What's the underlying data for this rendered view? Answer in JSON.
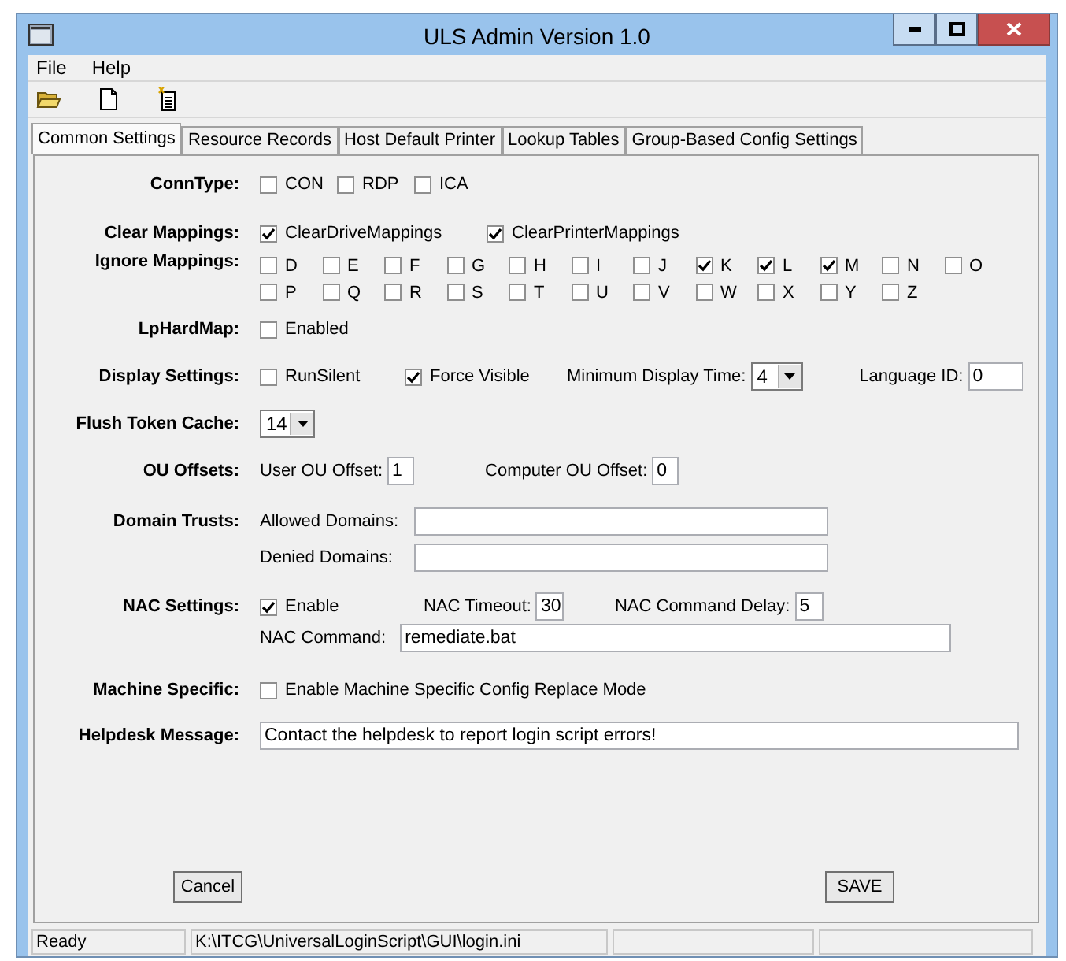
{
  "window": {
    "title": "ULS Admin Version 1.0"
  },
  "menu": [
    "File",
    "Help"
  ],
  "tabs": [
    {
      "label": "Common Settings",
      "selected": true
    },
    {
      "label": "Resource Records",
      "selected": false
    },
    {
      "label": "Host Default Printer",
      "selected": false
    },
    {
      "label": "Lookup Tables",
      "selected": false
    },
    {
      "label": "Group-Based Config Settings",
      "selected": false
    }
  ],
  "conn_type": {
    "label": "ConnType:",
    "options": [
      {
        "label": "CON",
        "checked": false
      },
      {
        "label": "RDP",
        "checked": false
      },
      {
        "label": "ICA",
        "checked": false
      }
    ]
  },
  "clear_mappings": {
    "label": "Clear Mappings:",
    "options": [
      {
        "label": "ClearDriveMappings",
        "checked": true
      },
      {
        "label": "ClearPrinterMappings",
        "checked": true
      }
    ]
  },
  "ignore_mappings": {
    "label": "Ignore Mappings:",
    "options": [
      {
        "label": "D",
        "checked": false
      },
      {
        "label": "E",
        "checked": false
      },
      {
        "label": "F",
        "checked": false
      },
      {
        "label": "G",
        "checked": false
      },
      {
        "label": "H",
        "checked": false
      },
      {
        "label": "I",
        "checked": false
      },
      {
        "label": "J",
        "checked": false
      },
      {
        "label": "K",
        "checked": true
      },
      {
        "label": "L",
        "checked": true
      },
      {
        "label": "M",
        "checked": true
      },
      {
        "label": "N",
        "checked": false
      },
      {
        "label": "O",
        "checked": false
      },
      {
        "label": "P",
        "checked": false
      },
      {
        "label": "Q",
        "checked": false
      },
      {
        "label": "R",
        "checked": false
      },
      {
        "label": "S",
        "checked": false
      },
      {
        "label": "T",
        "checked": false
      },
      {
        "label": "U",
        "checked": false
      },
      {
        "label": "V",
        "checked": false
      },
      {
        "label": "W",
        "checked": false
      },
      {
        "label": "X",
        "checked": false
      },
      {
        "label": "Y",
        "checked": false
      },
      {
        "label": "Z",
        "checked": false
      }
    ]
  },
  "lp_hard_map": {
    "label": "LpHardMap:",
    "option": {
      "label": "Enabled",
      "checked": false
    }
  },
  "display_settings": {
    "label": "Display Settings:",
    "run_silent": {
      "label": "RunSilent",
      "checked": false
    },
    "force_visible": {
      "label": "Force Visible",
      "checked": true
    },
    "min_display_time": {
      "label": "Minimum Display Time:",
      "value": "4"
    },
    "language_id": {
      "label": "Language ID:",
      "value": "0"
    }
  },
  "flush_token_cache": {
    "label": "Flush Token Cache:",
    "value": "14"
  },
  "ou_offsets": {
    "label": "OU Offsets:",
    "user": {
      "label": "User OU Offset:",
      "value": "1"
    },
    "computer": {
      "label": "Computer OU Offset:",
      "value": "0"
    }
  },
  "domain_trusts": {
    "label": "Domain Trusts:",
    "allowed": {
      "label": "Allowed Domains:"
    },
    "denied": {
      "label": "Denied Domains:"
    }
  },
  "nac_settings": {
    "label": "NAC Settings:",
    "enable": {
      "label": "Enable",
      "checked": true
    },
    "timeout": {
      "label": "NAC Timeout:",
      "value": "30"
    },
    "delay": {
      "label": "NAC Command Delay:",
      "value": "5"
    },
    "command": {
      "label": "NAC Command:",
      "value": "remediate.bat"
    }
  },
  "machine_specific": {
    "label": "Machine Specific:",
    "option": {
      "label": "Enable Machine Specific Config Replace Mode",
      "checked": false
    }
  },
  "helpdesk_message": {
    "label": "Helpdesk Message:",
    "value": "Contact the helpdesk to report login script errors!"
  },
  "buttons": {
    "cancel": "Cancel",
    "save": "SAVE"
  },
  "status_bar": [
    "Ready",
    "K:\\ITCG\\UniversalLoginScript\\GUI\\login.ini"
  ]
}
